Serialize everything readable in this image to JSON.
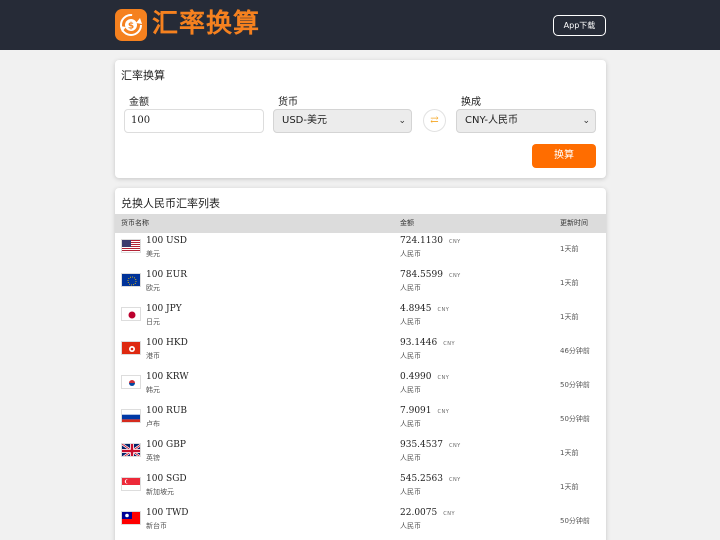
{
  "header": {
    "brand": "汇率换算",
    "app_button": "App下载",
    "logo_icon": "currency-exchange-icon",
    "accent": "#f5811f"
  },
  "converter": {
    "title": "汇率换算",
    "amount_label": "金额",
    "amount_value": "100",
    "from_label": "货币",
    "from_value": "USD-美元",
    "to_label": "换成",
    "to_value": "CNY-人民币",
    "swap_icon": "swap-arrows-icon",
    "convert_button": "换算",
    "button_color": "#ff6d00"
  },
  "rate_list": {
    "title": "兑换人民币汇率列表",
    "columns": [
      "货币名称",
      "金额",
      "更新时间"
    ],
    "unit": "CNY",
    "amount_sub": "人民币",
    "rows": [
      {
        "code": "100 USD",
        "name": "美元",
        "amount": "724.1130",
        "time": "1天前",
        "flag": "us-flag-icon"
      },
      {
        "code": "100 EUR",
        "name": "欧元",
        "amount": "784.5599",
        "time": "1天前",
        "flag": "eu-flag-icon"
      },
      {
        "code": "100 JPY",
        "name": "日元",
        "amount": "4.8945",
        "time": "1天前",
        "flag": "jp-flag-icon"
      },
      {
        "code": "100 HKD",
        "name": "港币",
        "amount": "93.1446",
        "time": "46分钟前",
        "flag": "hk-flag-icon"
      },
      {
        "code": "100 KRW",
        "name": "韩元",
        "amount": "0.4990",
        "time": "50分钟前",
        "flag": "kr-flag-icon"
      },
      {
        "code": "100 RUB",
        "name": "卢布",
        "amount": "7.9091",
        "time": "50分钟前",
        "flag": "ru-flag-icon"
      },
      {
        "code": "100 GBP",
        "name": "英镑",
        "amount": "935.4537",
        "time": "1天前",
        "flag": "gb-flag-icon"
      },
      {
        "code": "100 SGD",
        "name": "新加坡元",
        "amount": "545.2563",
        "time": "1天前",
        "flag": "sg-flag-icon"
      },
      {
        "code": "100 TWD",
        "name": "新台币",
        "amount": "22.0075",
        "time": "50分钟前",
        "flag": "tw-flag-icon"
      }
    ]
  }
}
